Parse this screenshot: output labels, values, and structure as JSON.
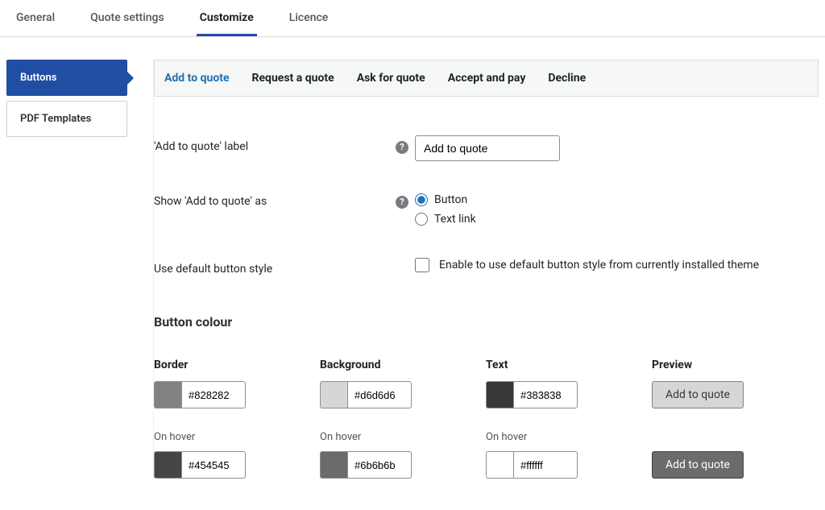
{
  "top_tabs": {
    "general": "General",
    "quote_settings": "Quote settings",
    "customize": "Customize",
    "licence": "Licence"
  },
  "side_nav": {
    "buttons": "Buttons",
    "pdf_templates": "PDF Templates"
  },
  "inner_tabs": {
    "add_to_quote": "Add to quote",
    "request_a_quote": "Request a quote",
    "ask_for_quote": "Ask for quote",
    "accept_and_pay": "Accept and pay",
    "decline": "Decline"
  },
  "fields": {
    "label_field_label": "'Add to quote' label",
    "label_field_value": "Add to quote",
    "show_as_label": "Show 'Add to quote' as",
    "show_as_options": {
      "button": "Button",
      "text_link": "Text link"
    },
    "default_style_label": "Use default button style",
    "default_style_desc": "Enable to use default button style from currently installed theme"
  },
  "section_title": "Button colour",
  "colors": {
    "border": {
      "head": "Border",
      "value": "#828282"
    },
    "background": {
      "head": "Background",
      "value": "#d6d6d6"
    },
    "text": {
      "head": "Text",
      "value": "#383838"
    },
    "preview": {
      "head": "Preview",
      "label": "Add to quote"
    },
    "hover_label": "On hover",
    "border_hover": {
      "value": "#454545"
    },
    "background_hover": {
      "value": "#6b6b6b"
    },
    "text_hover": {
      "value": "#ffffff"
    },
    "preview_hover_label": "Add to quote"
  }
}
